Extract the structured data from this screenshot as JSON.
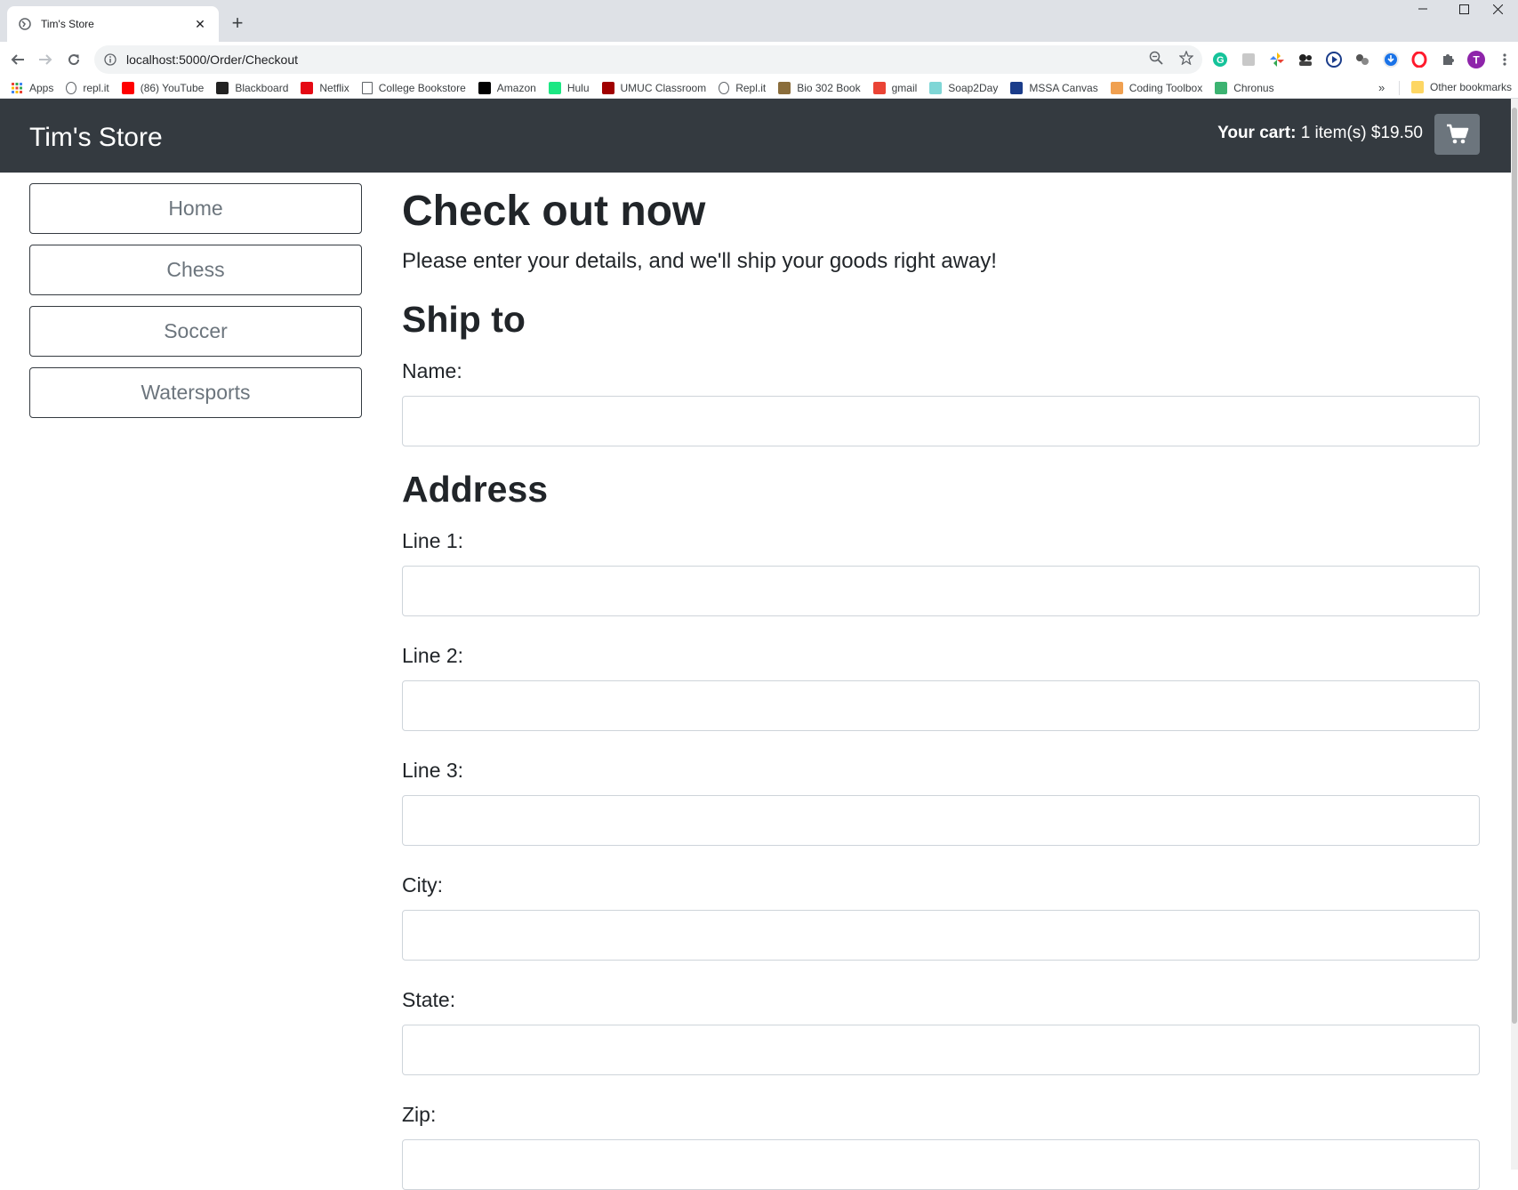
{
  "browser": {
    "tab_title": "Tim's Store",
    "url": "localhost:5000/Order/Checkout",
    "bookmarks": [
      {
        "label": "Apps",
        "icon": "apps-grid-icon",
        "color": "#ea4335"
      },
      {
        "label": "repl.it",
        "icon": "replit-icon",
        "color": "#5f6368"
      },
      {
        "label": "(86) YouTube",
        "icon": "youtube-icon",
        "color": "#ff0000"
      },
      {
        "label": "Blackboard",
        "icon": "blackboard-icon",
        "color": "#222222"
      },
      {
        "label": "Netflix",
        "icon": "netflix-icon",
        "color": "#e50914"
      },
      {
        "label": "College Bookstore",
        "icon": "page-icon",
        "color": "#5f6368"
      },
      {
        "label": "Amazon",
        "icon": "amazon-icon",
        "color": "#000000"
      },
      {
        "label": "Hulu",
        "icon": "hulu-icon",
        "color": "#1ce783"
      },
      {
        "label": "UMUC Classroom",
        "icon": "umuc-icon",
        "color": "#a00000"
      },
      {
        "label": "Repl.it",
        "icon": "replit-icon",
        "color": "#5f6368"
      },
      {
        "label": "Bio 302 Book",
        "icon": "book-icon",
        "color": "#8a6d3b"
      },
      {
        "label": "gmail",
        "icon": "gmail-icon",
        "color": "#ea4335"
      },
      {
        "label": "Soap2Day",
        "icon": "soap2day-icon",
        "color": "#7fd6d6"
      },
      {
        "label": "MSSA Canvas",
        "icon": "canvas-icon",
        "color": "#1a3c8a"
      },
      {
        "label": "Coding Toolbox",
        "icon": "toolbox-icon",
        "color": "#f0a050"
      },
      {
        "label": "Chronus",
        "icon": "chronus-icon",
        "color": "#3cb371"
      }
    ],
    "more_bookmarks": "»",
    "other_bookmarks": "Other bookmarks",
    "profile_initial": "T"
  },
  "store": {
    "brand": "Tim's Store",
    "cart_label": "Your cart:",
    "cart_summary": "1 item(s) $19.50"
  },
  "categories": [
    "Home",
    "Chess",
    "Soccer",
    "Watersports"
  ],
  "checkout": {
    "title": "Check out now",
    "lead": "Please enter your details, and we'll ship your goods right away!",
    "ship_to_heading": "Ship to",
    "name_label": "Name:",
    "address_heading": "Address",
    "line1_label": "Line 1:",
    "line2_label": "Line 2:",
    "line3_label": "Line 3:",
    "city_label": "City:",
    "state_label": "State:",
    "zip_label": "Zip:",
    "values": {
      "name": "",
      "line1": "",
      "line2": "",
      "line3": "",
      "city": "",
      "state": "",
      "zip": ""
    }
  },
  "colors": {
    "navbar": "#343a40",
    "cart_button": "#6c757d",
    "text": "#212529"
  }
}
